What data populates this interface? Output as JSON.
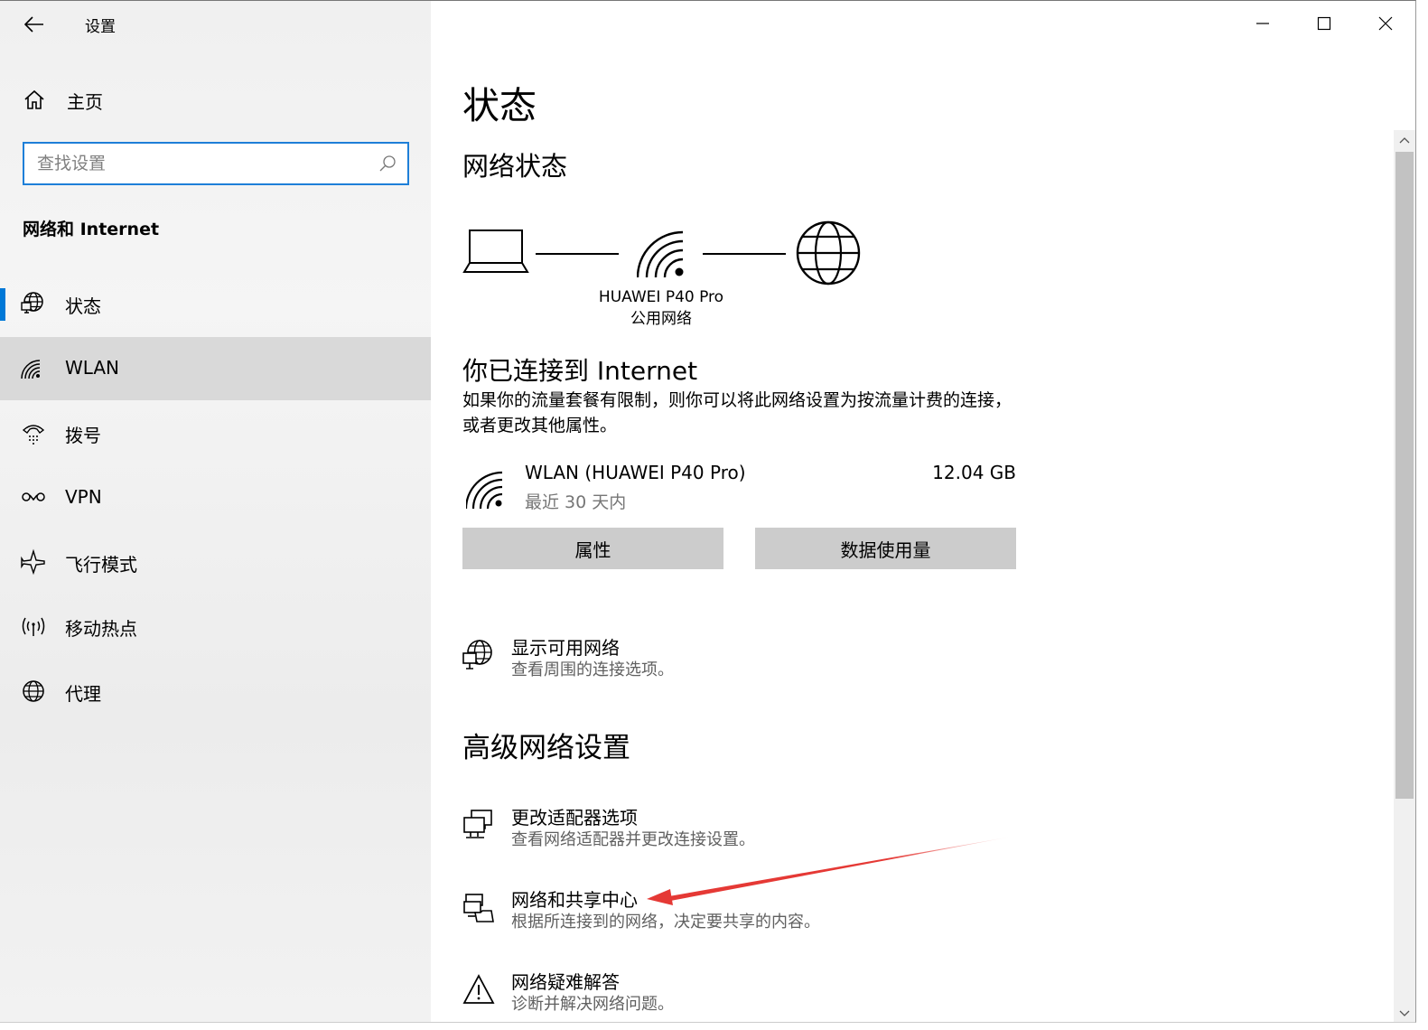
{
  "window": {
    "app_title": "设置",
    "home_label": "主页",
    "search_placeholder": "查找设置",
    "section_title": "网络和 Internet"
  },
  "sidebar": {
    "items": [
      {
        "label": "状态",
        "icon": "globe-monitor-icon",
        "selected": true
      },
      {
        "label": "WLAN",
        "icon": "wifi-icon"
      },
      {
        "label": "拨号",
        "icon": "dialup-icon"
      },
      {
        "label": "VPN",
        "icon": "vpn-icon"
      },
      {
        "label": "飞行模式",
        "icon": "airplane-icon"
      },
      {
        "label": "移动热点",
        "icon": "hotspot-icon"
      },
      {
        "label": "代理",
        "icon": "globe-icon"
      }
    ]
  },
  "main": {
    "page_title": "状态",
    "network_status_heading": "网络状态",
    "diagram": {
      "network_name": "HUAWEI P40 Pro",
      "network_type": "公用网络"
    },
    "connected_heading": "你已连接到 Internet",
    "connected_desc": "如果你的流量套餐有限制，则你可以将此网络设置为按流量计费的连接，或者更改其他属性。",
    "connection": {
      "name": "WLAN (HUAWEI P40 Pro)",
      "period": "最近 30 天内",
      "usage": "12.04 GB"
    },
    "buttons": {
      "properties": "属性",
      "data_usage": "数据使用量"
    },
    "show_networks": {
      "title": "显示可用网络",
      "desc": "查看周围的连接选项。"
    },
    "advanced_heading": "高级网络设置",
    "advanced": [
      {
        "title": "更改适配器选项",
        "desc": "查看网络适配器并更改连接设置。"
      },
      {
        "title": "网络和共享中心",
        "desc": "根据所连接到的网络，决定要共享的内容。"
      },
      {
        "title": "网络疑难解答",
        "desc": "诊断并解决网络问题。"
      }
    ]
  },
  "colors": {
    "accent": "#0078d7",
    "annotation_arrow": "#e53935"
  }
}
